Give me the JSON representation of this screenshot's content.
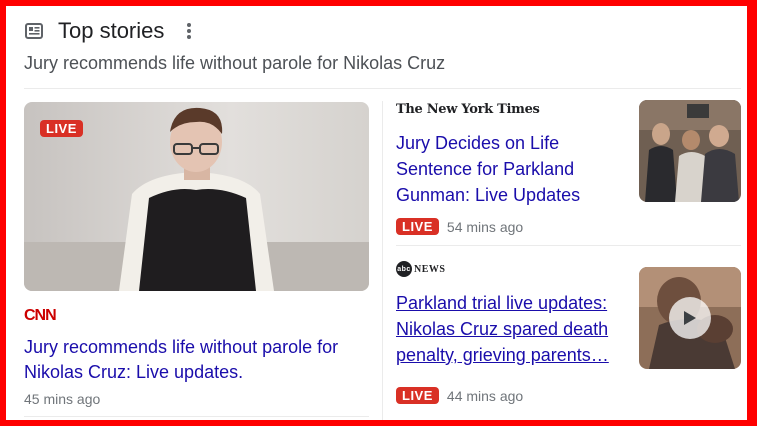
{
  "header": {
    "title": "Top stories",
    "subtitle": "Jury recommends life without parole for Nikolas Cruz"
  },
  "icons": {
    "news": "newspaper-icon",
    "more": "more-vertical-icon",
    "play": "play-icon"
  },
  "lead_story": {
    "badge": "LIVE",
    "source": "CNN",
    "title": "Jury recommends life without parole for Nikolas Cruz: Live updates.",
    "time": "45 mins ago"
  },
  "stories": [
    {
      "source": "The New York Times",
      "title": "Jury Decides on Life Sentence for Parkland Gunman: Live Updates",
      "badge": "LIVE",
      "time": "54 mins ago"
    },
    {
      "source_mark": "abc",
      "source_word": "NEWS",
      "title": "Parkland trial live updates: Nikolas Cruz spared death penalty, grieving parents…",
      "badge": "LIVE",
      "time": "44 mins ago"
    }
  ],
  "colors": {
    "frame_border": "#ff0000",
    "link": "#1a0dab",
    "live": "#d93025",
    "cnn": "#cc0000"
  }
}
